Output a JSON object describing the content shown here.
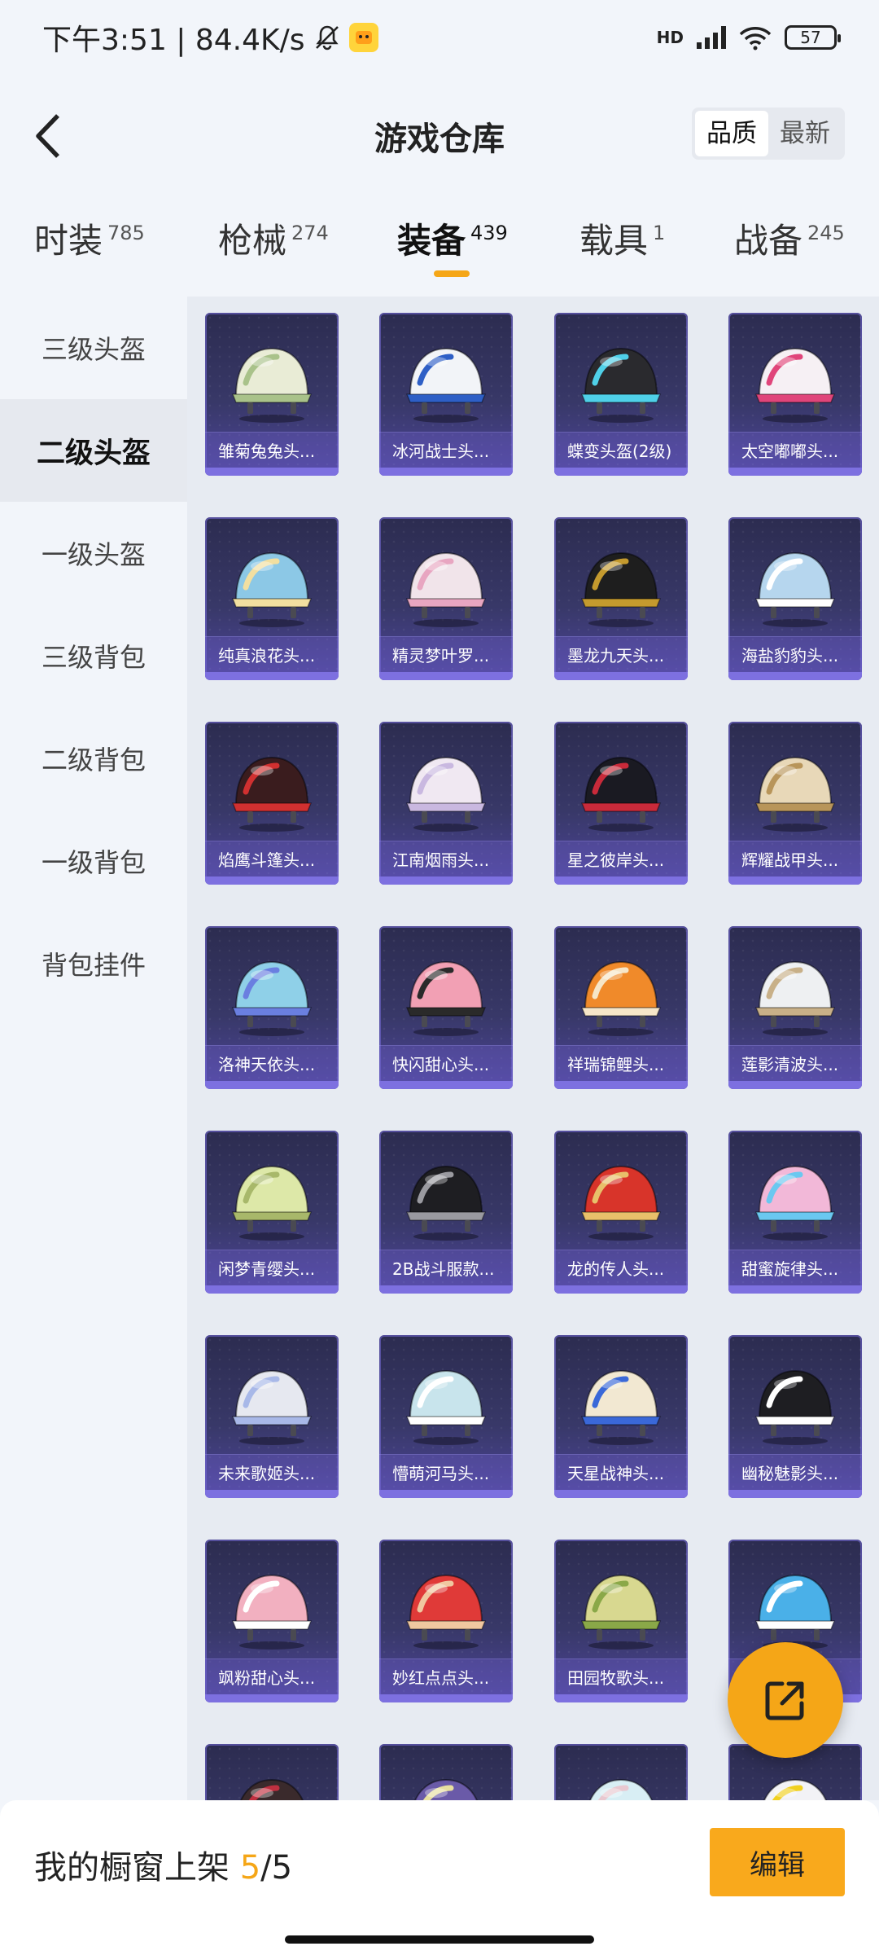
{
  "status_bar": {
    "time_and_speed": "下午3:51 | 84.4K/s",
    "network_label": "HD",
    "battery": "57"
  },
  "header": {
    "title": "游戏仓库",
    "sort_options": [
      "品质",
      "最新"
    ],
    "sort_selected": "品质"
  },
  "category_tabs": [
    {
      "label": "时装",
      "count": "785"
    },
    {
      "label": "枪械",
      "count": "274"
    },
    {
      "label": "装备",
      "count": "439"
    },
    {
      "label": "载具",
      "count": "1"
    },
    {
      "label": "战备",
      "count": "245"
    }
  ],
  "active_category": "装备",
  "sidebar": {
    "items": [
      "三级头盔",
      "二级头盔",
      "一级头盔",
      "三级背包",
      "二级背包",
      "一级背包",
      "背包挂件"
    ],
    "active": "二级头盔"
  },
  "items": [
    {
      "name": "雏菊兔兔头...",
      "color": "#e9ecd6",
      "accent": "#a9c28a"
    },
    {
      "name": "冰河战士头...",
      "color": "#f2f4f8",
      "accent": "#2e5fc6"
    },
    {
      "name": "蝶变头盔(2级)",
      "color": "#2a2a2e",
      "accent": "#4fd0e8"
    },
    {
      "name": "太空嘟嘟头...",
      "color": "#f6f0f4",
      "accent": "#e0457a"
    },
    {
      "name": "纯真浪花头...",
      "color": "#8cc8e6",
      "accent": "#f2dfa0"
    },
    {
      "name": "精灵梦叶罗...",
      "color": "#f1e4ea",
      "accent": "#e8a6c1"
    },
    {
      "name": "墨龙九天头...",
      "color": "#1e1e1e",
      "accent": "#c49a2e"
    },
    {
      "name": "海盐豹豹头...",
      "color": "#b6d6ee",
      "accent": "#ffffff"
    },
    {
      "name": "焰鹰斗篷头...",
      "color": "#3a1c1e",
      "accent": "#d03030"
    },
    {
      "name": "江南烟雨头...",
      "color": "#f0e8f2",
      "accent": "#c9b8e0"
    },
    {
      "name": "星之彼岸头...",
      "color": "#1a1a22",
      "accent": "#c82a3a"
    },
    {
      "name": "辉耀战甲头...",
      "color": "#e8d8b8",
      "accent": "#b8955a"
    },
    {
      "name": "洛神天依头...",
      "color": "#8fd0e8",
      "accent": "#6a7fe0"
    },
    {
      "name": "快闪甜心头...",
      "color": "#f2a0b4",
      "accent": "#2a2a2a"
    },
    {
      "name": "祥瑞锦鲤头...",
      "color": "#f08a2a",
      "accent": "#f6e6c8"
    },
    {
      "name": "莲影清波头...",
      "color": "#eef0f2",
      "accent": "#c8b088"
    },
    {
      "name": "闲梦青缨头...",
      "color": "#dde8a8",
      "accent": "#a8b86a"
    },
    {
      "name": "2B战斗服款...",
      "color": "#1e1e22",
      "accent": "#9a9aa0"
    },
    {
      "name": "龙的传人头...",
      "color": "#d8342a",
      "accent": "#e8c06a"
    },
    {
      "name": "甜蜜旋律头...",
      "color": "#f2b8d8",
      "accent": "#6ac8f0"
    },
    {
      "name": "未来歌姬头...",
      "color": "#e6e8f0",
      "accent": "#a8b8e8"
    },
    {
      "name": "懵萌河马头...",
      "color": "#c8e4ec",
      "accent": "#ffffff"
    },
    {
      "name": "天星战神头...",
      "color": "#f2e8d2",
      "accent": "#3a68d8"
    },
    {
      "name": "幽秘魅影头...",
      "color": "#1e1e22",
      "accent": "#ffffff"
    },
    {
      "name": "飒粉甜心头...",
      "color": "#f2b0c0",
      "accent": "#ffffff"
    },
    {
      "name": "妙红点点头...",
      "color": "#e03a38",
      "accent": "#f0c8a0"
    },
    {
      "name": "田园牧歌头...",
      "color": "#d8d890",
      "accent": "#8aa848"
    },
    {
      "name": "",
      "color": "#4ab0e8",
      "accent": "#ffffff"
    },
    {
      "name": "",
      "color": "#3a2a2c",
      "accent": "#c03040"
    },
    {
      "name": "",
      "color": "#6a5aa8",
      "accent": "#e8e0a0"
    },
    {
      "name": "",
      "color": "#d8eef4",
      "accent": "#e8c8d0"
    },
    {
      "name": "",
      "color": "#f2f2f6",
      "accent": "#f0d020"
    }
  ],
  "bottom_bar": {
    "showcase_label": "我的橱窗上架",
    "showcase_current": "5",
    "showcase_sep": "/",
    "showcase_total": "5",
    "edit_label": "编辑"
  }
}
